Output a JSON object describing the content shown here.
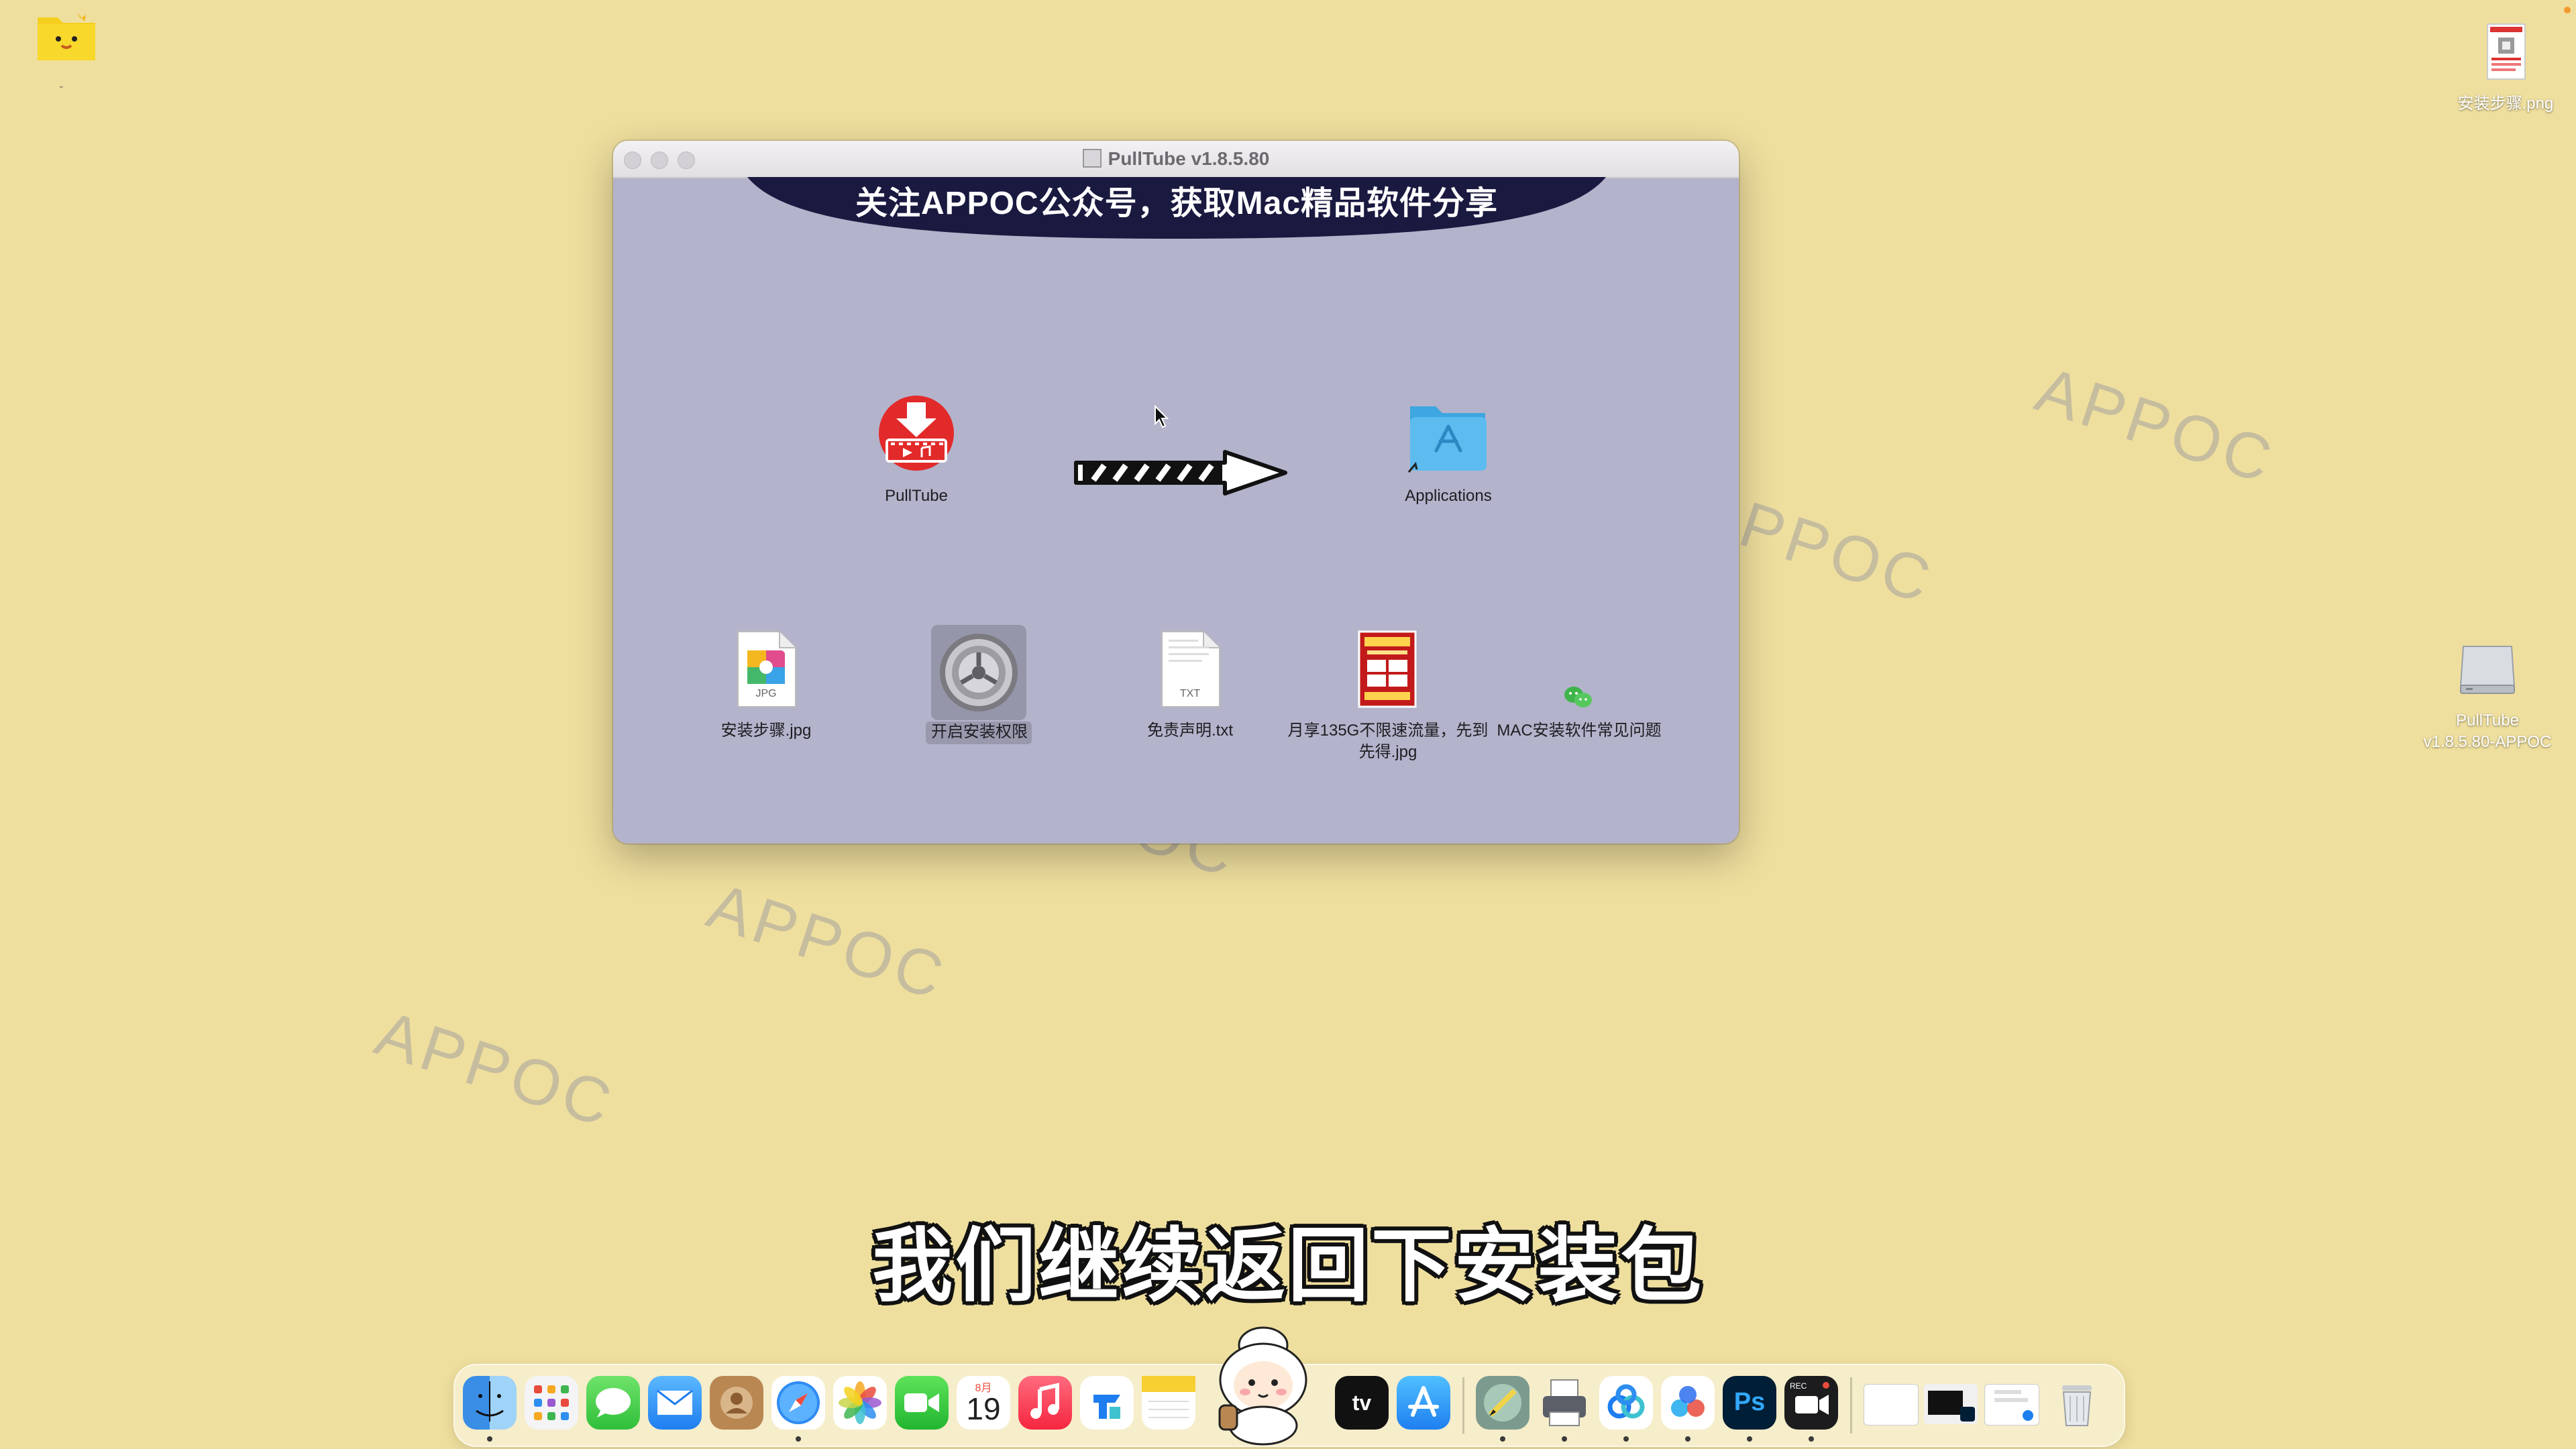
{
  "desktop": {
    "top_left_label": "-",
    "icons": [
      {
        "label": "安装步骤.png"
      },
      {
        "label_line1": "PullTube",
        "label_line2": "v1.8.5.80-APPOC"
      }
    ],
    "watermarks": [
      "APPOC",
      "PPOC",
      "APPOC",
      "APPOC",
      "OC"
    ]
  },
  "window": {
    "title": "PullTube v1.8.5.80",
    "banner": "关注APPOC公众号，获取Mac精品软件分享",
    "app_item": {
      "label": "PullTube"
    },
    "folder_item": {
      "label": "Applications"
    },
    "files": [
      {
        "label": "安装步骤.jpg",
        "badge": "JPG"
      },
      {
        "label": "开启安装权限"
      },
      {
        "label": "免责声明.txt",
        "badge": "TXT"
      },
      {
        "label_line1": "月享135G不限速流量，先到",
        "label_line2": "先得.jpg"
      },
      {
        "label": "MAC安装软件常见问题"
      }
    ]
  },
  "subtitle": "我们继续返回下安装包",
  "dock": {
    "calendar_month": "8月",
    "calendar_day": "19",
    "tv_label": "tv",
    "ps_label": "Ps",
    "rec_label": "REC"
  },
  "colors": {
    "desktop_bg": "#efdf9e",
    "window_bg": "#b3b3cb",
    "banner_bg": "#1a1940",
    "pulltube_red": "#e22a2a",
    "folder_blue": "#4fb3ea"
  }
}
